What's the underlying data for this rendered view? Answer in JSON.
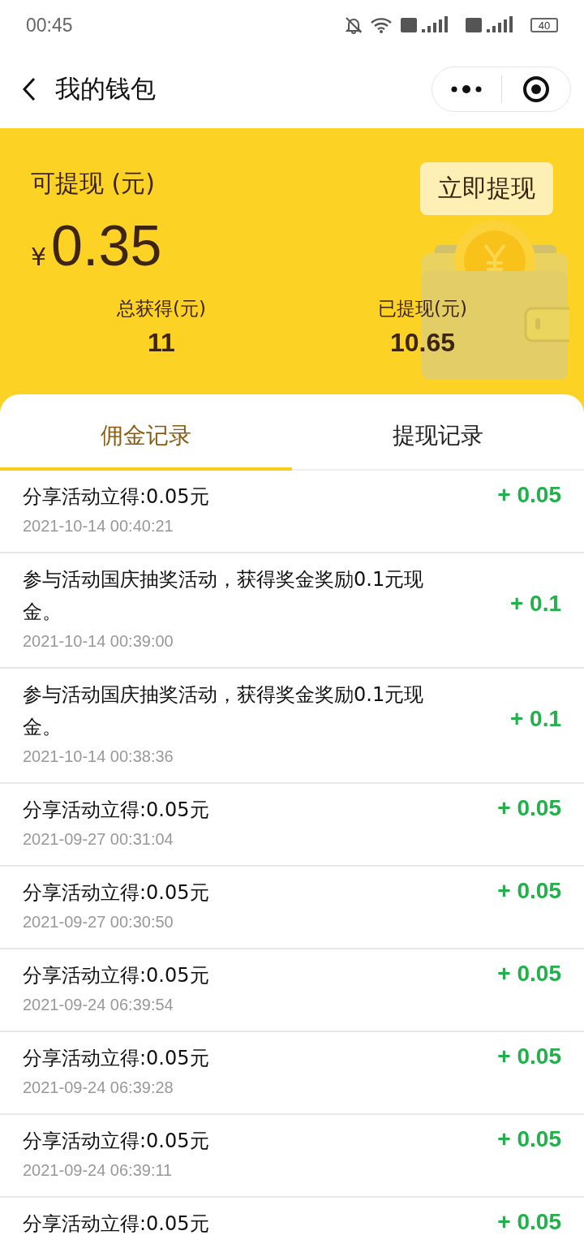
{
  "status_bar": {
    "time": "00:45",
    "battery": "40"
  },
  "nav": {
    "title": "我的钱包"
  },
  "wallet": {
    "available_label": "可提现 (元)",
    "currency": "¥",
    "available_amount": "0.35",
    "withdraw_button": "立即提现",
    "stats": [
      {
        "label": "总获得(元)",
        "value": "11"
      },
      {
        "label": "已提现(元)",
        "value": "10.65"
      }
    ]
  },
  "tabs": [
    {
      "label": "佣金记录",
      "selected": true
    },
    {
      "label": "提现记录",
      "selected": false
    }
  ],
  "records": [
    {
      "title": "分享活动立得:0.05元",
      "time": "2021-10-14 00:40:21",
      "amount": "+ 0.05"
    },
    {
      "title": "参与活动国庆抽奖活动，获得奖金奖励0.1元现金。",
      "time": "2021-10-14 00:39:00",
      "amount": "+ 0.1"
    },
    {
      "title": "参与活动国庆抽奖活动，获得奖金奖励0.1元现金。",
      "time": "2021-10-14 00:38:36",
      "amount": "+ 0.1"
    },
    {
      "title": "分享活动立得:0.05元",
      "time": "2021-09-27 00:31:04",
      "amount": "+ 0.05"
    },
    {
      "title": "分享活动立得:0.05元",
      "time": "2021-09-27 00:30:50",
      "amount": "+ 0.05"
    },
    {
      "title": "分享活动立得:0.05元",
      "time": "2021-09-24 06:39:54",
      "amount": "+ 0.05"
    },
    {
      "title": "分享活动立得:0.05元",
      "time": "2021-09-24 06:39:28",
      "amount": "+ 0.05"
    },
    {
      "title": "分享活动立得:0.05元",
      "time": "2021-09-24 06:39:11",
      "amount": "+ 0.05"
    },
    {
      "title": "分享活动立得:0.05元",
      "amount": "+ 0.05"
    }
  ]
}
